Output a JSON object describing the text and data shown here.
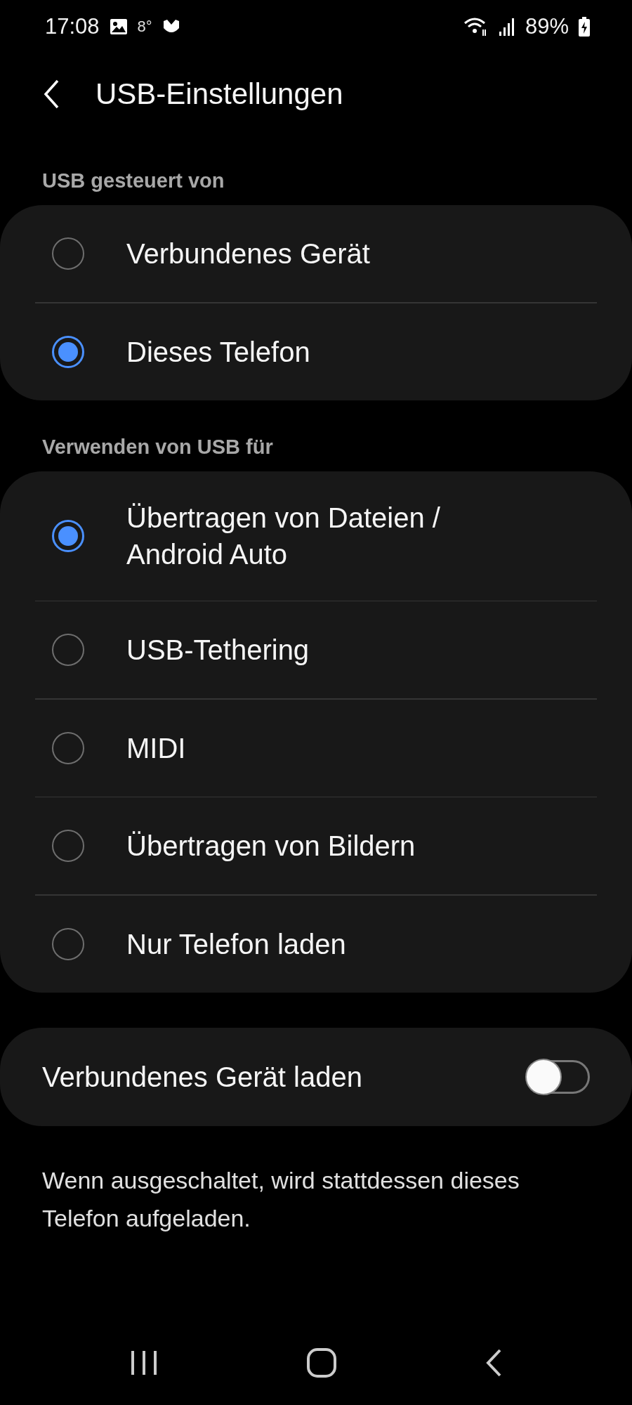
{
  "status_bar": {
    "time": "17:08",
    "temperature": "8°",
    "battery": "89%"
  },
  "header": {
    "title": "USB-Einstellungen"
  },
  "sections": [
    {
      "label": "USB gesteuert von",
      "options": [
        {
          "label": "Verbundenes Gerät",
          "selected": false
        },
        {
          "label": "Dieses Telefon",
          "selected": true
        }
      ]
    },
    {
      "label": "Verwenden von USB für",
      "options": [
        {
          "label": "Übertragen von Dateien /\nAndroid Auto",
          "selected": true
        },
        {
          "label": "USB-Tethering",
          "selected": false
        },
        {
          "label": "MIDI",
          "selected": false
        },
        {
          "label": "Übertragen von Bildern",
          "selected": false
        },
        {
          "label": "Nur Telefon laden",
          "selected": false
        }
      ]
    }
  ],
  "toggle": {
    "label": "Verbundenes Gerät laden",
    "on": false
  },
  "note": "Wenn ausgeschaltet, wird stattdessen dieses Telefon aufgeladen."
}
